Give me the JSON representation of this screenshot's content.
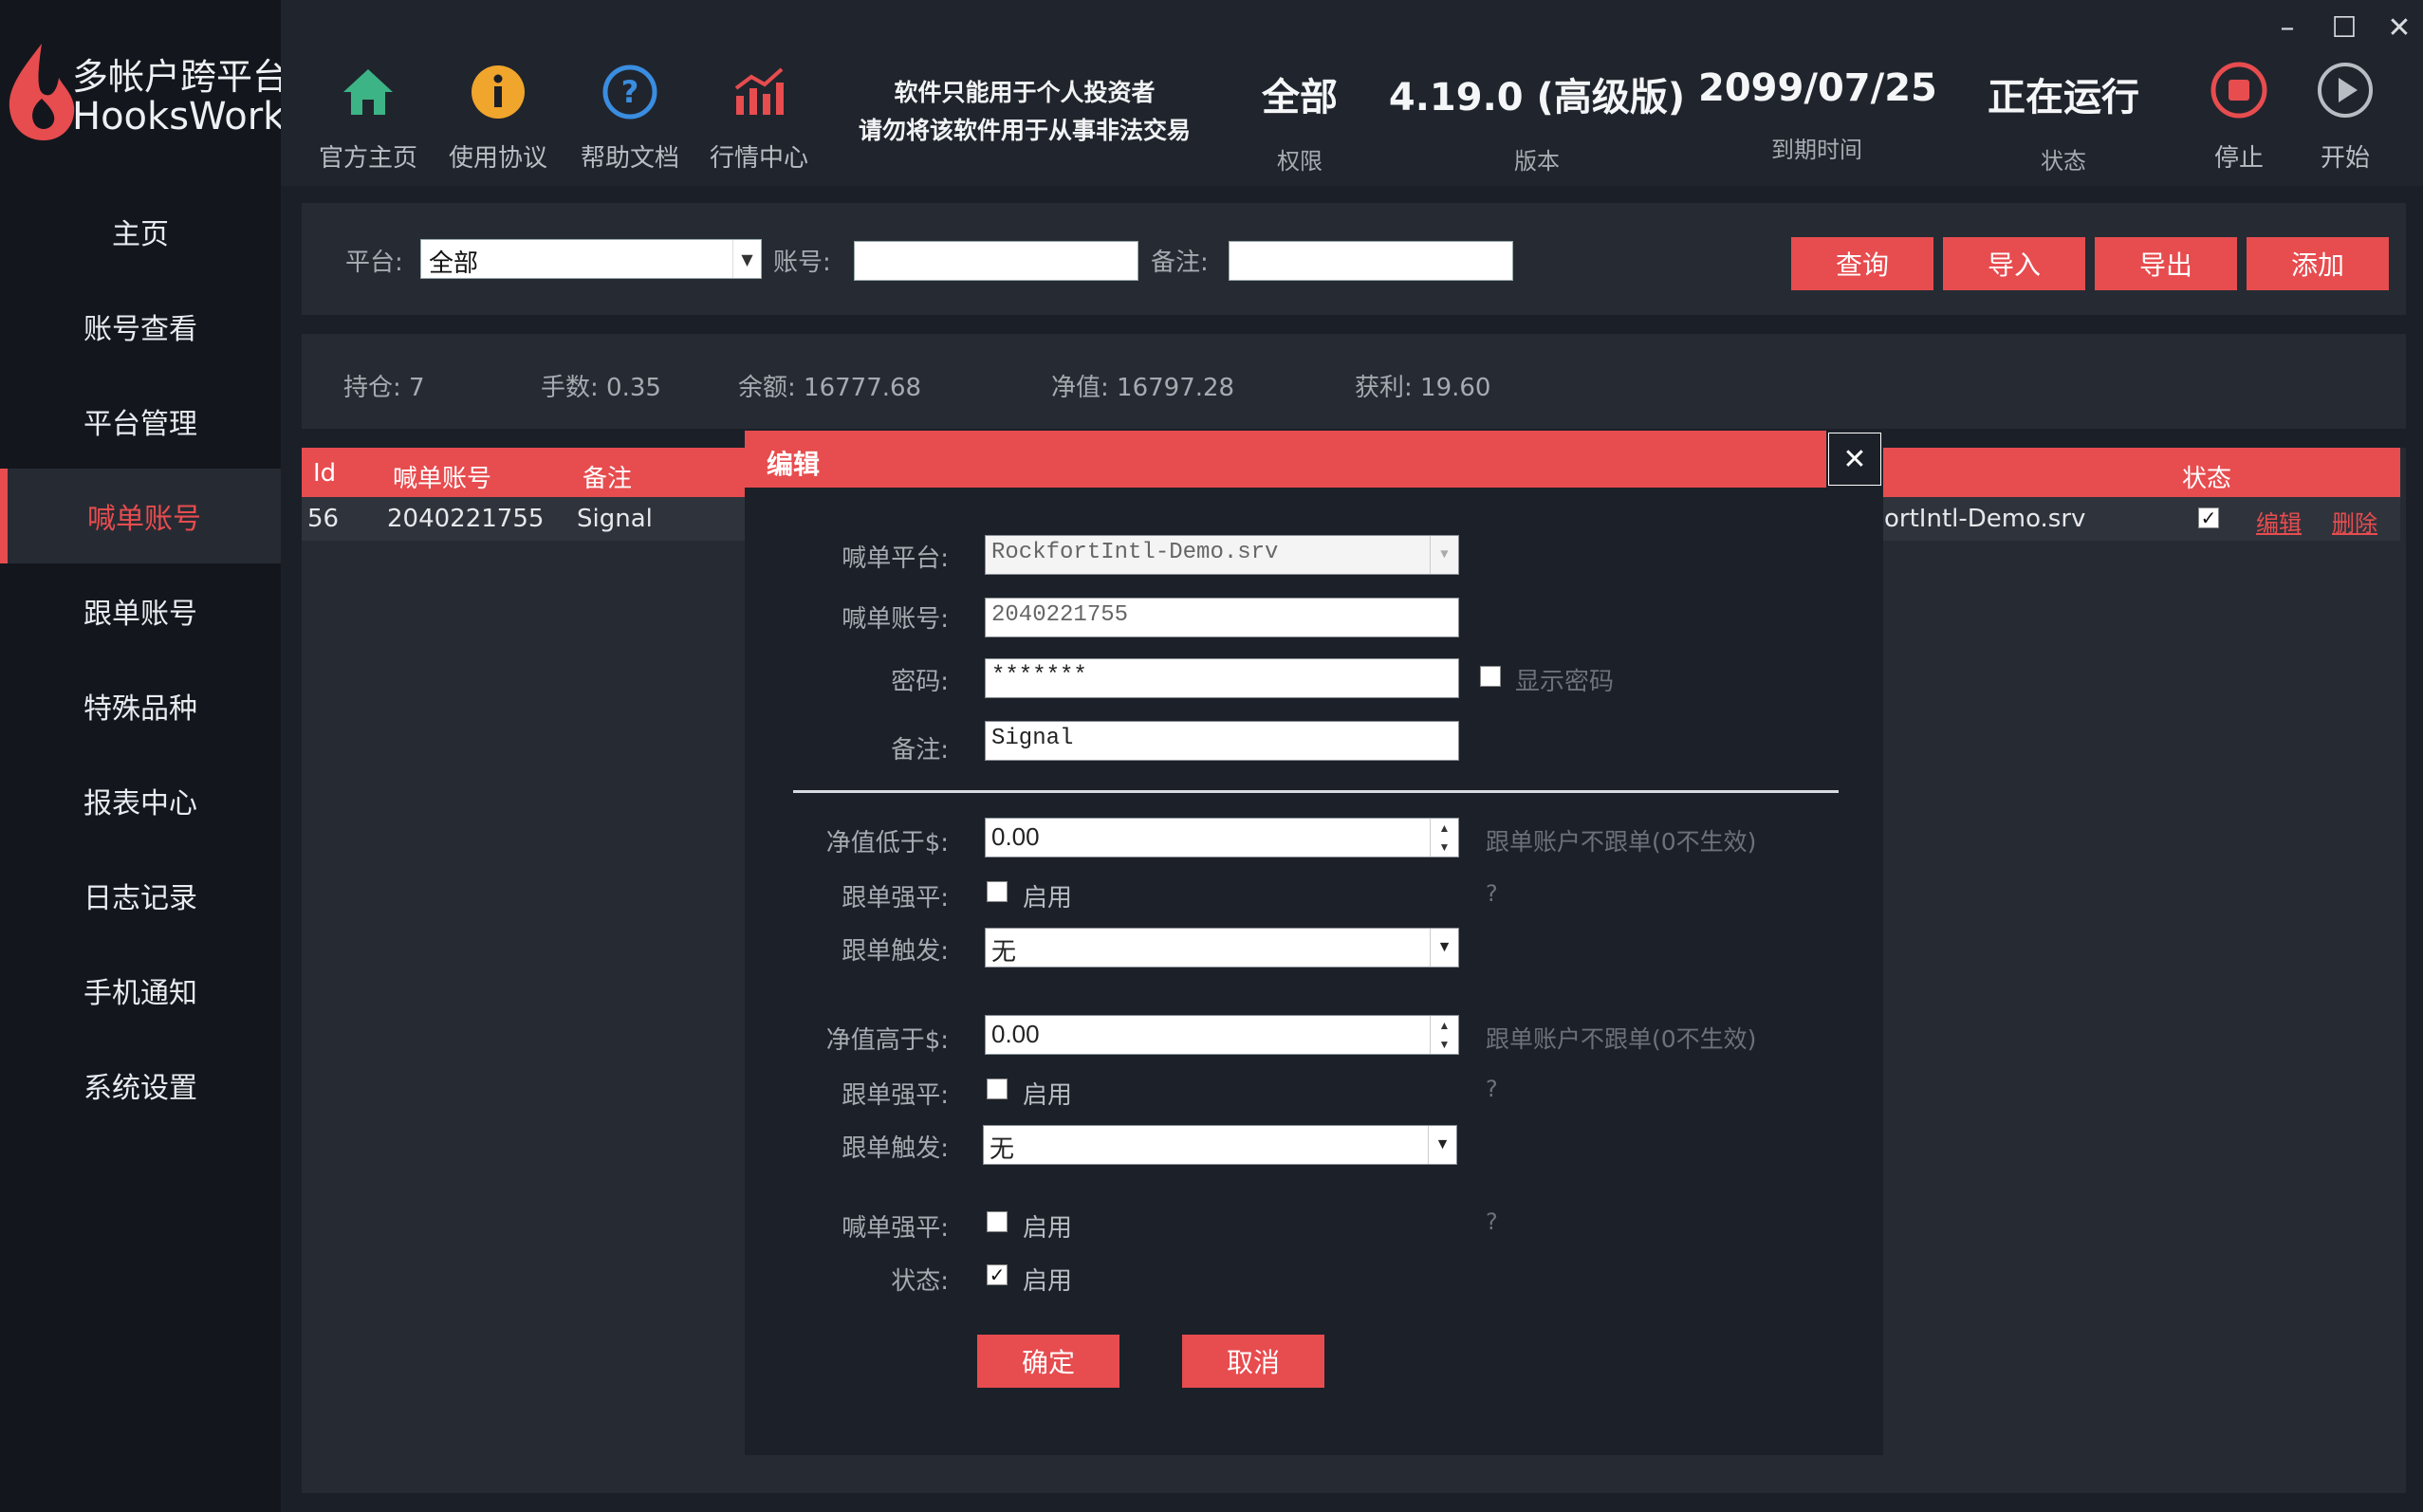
{
  "app": {
    "title_line1": "多帐户跨平台",
    "title_line2": "HooksWork"
  },
  "colors": {
    "accent": "#e74c4f",
    "sidebar_bg": "#13171d",
    "panel_bg": "#262b33",
    "toolbar_bg": "#20252d"
  },
  "toolbar": {
    "tools": [
      {
        "label": "官方主页",
        "icon": "home-icon"
      },
      {
        "label": "使用协议",
        "icon": "info-icon"
      },
      {
        "label": "帮助文档",
        "icon": "help-icon"
      },
      {
        "label": "行情中心",
        "icon": "chart-icon"
      }
    ],
    "notice_line1": "软件只能用于个人投资者",
    "notice_line2": "请勿将该软件用于从事非法交易",
    "info": [
      {
        "value": "全部",
        "key": "权限"
      },
      {
        "value": "4.19.0 (高级版)",
        "key": "版本"
      },
      {
        "value": "2099/07/25",
        "key": "到期时间"
      },
      {
        "value": "正在运行",
        "key": "状态"
      }
    ],
    "stop_label": "停止",
    "start_label": "开始",
    "window": {
      "minimize": "–",
      "maximize": "☐",
      "close": "✕"
    }
  },
  "sidebar": {
    "items": [
      {
        "label": "主页"
      },
      {
        "label": "账号查看"
      },
      {
        "label": "平台管理"
      },
      {
        "label": "喊单账号",
        "active": true
      },
      {
        "label": "跟单账号"
      },
      {
        "label": "特殊品种"
      },
      {
        "label": "报表中心"
      },
      {
        "label": "日志记录"
      },
      {
        "label": "手机通知"
      },
      {
        "label": "系统设置"
      }
    ]
  },
  "filter": {
    "platform_label": "平台:",
    "platform_value": "全部",
    "account_label": "账号:",
    "account_value": "",
    "note_label": "备注:",
    "note_value": "",
    "buttons": {
      "query": "查询",
      "import": "导入",
      "export": "导出",
      "add": "添加"
    }
  },
  "stats": {
    "positions": "持仓: 7",
    "lots": "手数: 0.35",
    "balance": "余额: 16777.68",
    "equity": "净值: 16797.28",
    "profit": "获利: 19.60"
  },
  "table": {
    "headers": {
      "id": "Id",
      "account": "喊单账号",
      "note": "备注",
      "status": "状态"
    },
    "row": {
      "id": "56",
      "account": "2040221755",
      "note": "Signal",
      "server": "ortIntl-Demo.srv",
      "status_checked": true,
      "edit": "编辑",
      "delete": "删除"
    }
  },
  "dialog": {
    "title": "编辑",
    "close": "✕",
    "platform_label": "喊单平台:",
    "platform_value": "RockfortIntl-Demo.srv",
    "account_label": "喊单账号:",
    "account_value": "2040221755",
    "password_label": "密码:",
    "password_value": "*******",
    "show_password_label": "显示密码",
    "note_label": "备注:",
    "note_value": "Signal",
    "equity_low_label": "净值低于$:",
    "equity_low_value": "0.00",
    "equity_low_hint": "跟单账户不跟单(0不生效)",
    "force_close_label_1": "跟单强平:",
    "enable_label": "启用",
    "question": "?",
    "trigger_label_1": "跟单触发:",
    "trigger_value_1": "无",
    "equity_high_label": "净值高于$:",
    "equity_high_value": "0.00",
    "equity_high_hint": "跟单账户不跟单(0不生效)",
    "force_close_label_2": "跟单强平:",
    "trigger_label_2": "跟单触发:",
    "trigger_value_2": "无",
    "signal_force_label": "喊单强平:",
    "status_label": "状态:",
    "status_checked": true,
    "ok": "确定",
    "cancel": "取消"
  }
}
